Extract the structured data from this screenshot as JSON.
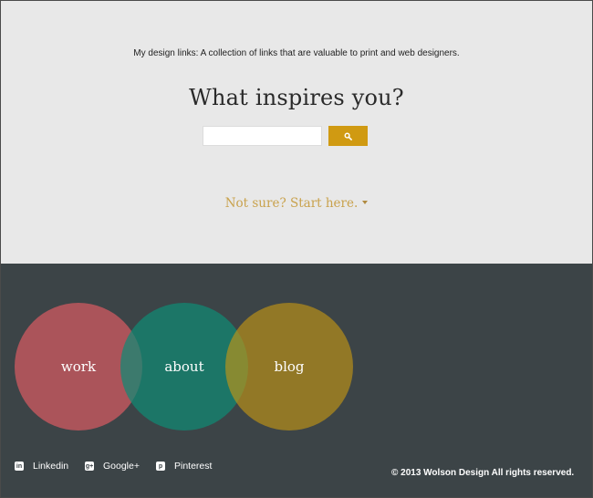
{
  "header": {
    "tagline": "My design links: A collection of links that are valuable to print and web designers.",
    "headline": "What inspires you?"
  },
  "search": {
    "value": "",
    "placeholder": "",
    "button_icon": "search-icon"
  },
  "start_link": {
    "label": "Not sure? Start here.",
    "icon": "caret-down-icon"
  },
  "nav_circles": [
    {
      "label": "work",
      "color": "#d75a62"
    },
    {
      "label": "about",
      "color": "#108974"
    },
    {
      "label": "blog",
      "color": "#c39614"
    }
  ],
  "social": [
    {
      "label": "Linkedin",
      "icon": "linkedin-icon"
    },
    {
      "label": "Google+",
      "icon": "google-plus-icon"
    },
    {
      "label": "Pinterest",
      "icon": "pinterest-icon"
    }
  ],
  "footer": {
    "copyright": "© 2013 Wolson Design All rights reserved."
  },
  "colors": {
    "top_background": "#e8e8e8",
    "bottom_background": "#3c4447",
    "accent": "#d09a12",
    "link": "#c9a24d"
  }
}
